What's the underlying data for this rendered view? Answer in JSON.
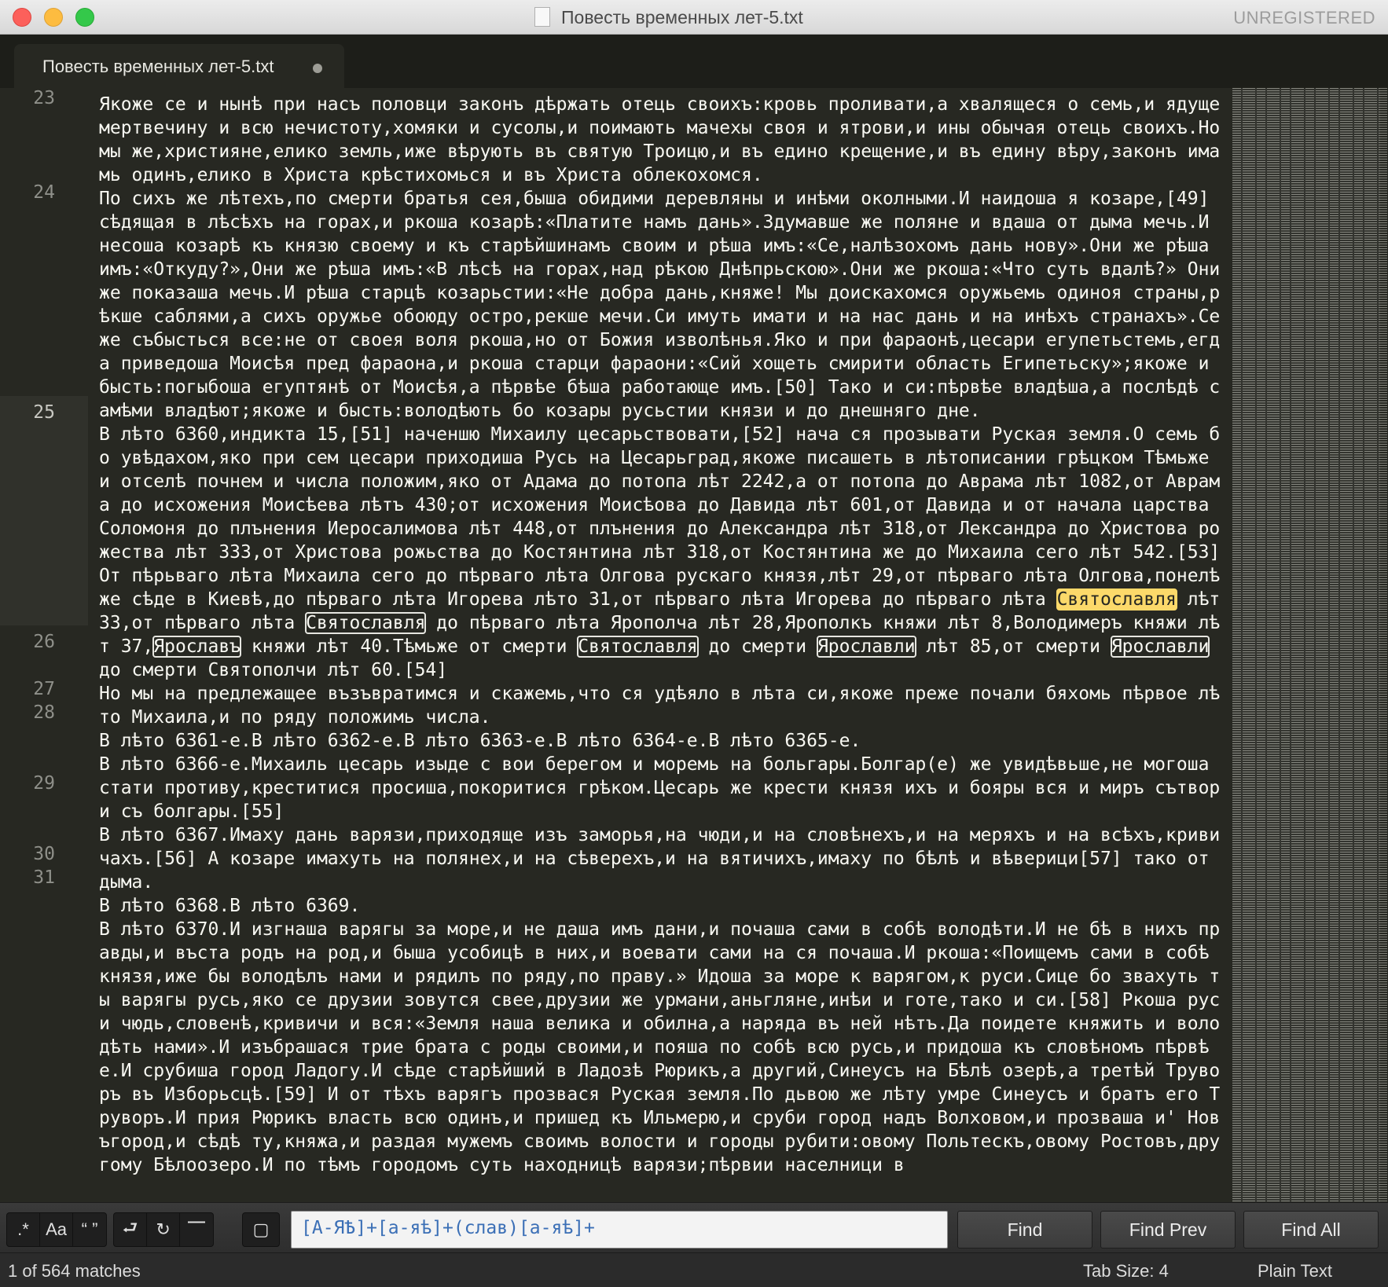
{
  "window": {
    "title": "Повесть временных лет-5.txt",
    "registration": "UNREGISTERED"
  },
  "tab": {
    "label": "Повесть временных лет-5.txt"
  },
  "editor": {
    "line_numbers": [
      "23",
      "24",
      "25",
      "26",
      "27",
      "28",
      "29",
      "30",
      "31"
    ],
    "active_line": "25",
    "paragraphs": [
      "Якоже се и нынѣ при насъ половци законъ дѣржать отець своихъ:кровь проливати,а хвалящеся о семь,и ядуще мертвечину и всю нечистоту,хомяки и сусолы,и поимають мачехы своя и ятрови,и ины обычая отець своихъ.Но мы же,християне,елико земль,иже вѣрують въ святую Троицю,и въ едино крещение,и въ едину вѣру,законъ имамь одинъ,елико в Христа крѣстихомься и въ Христа облекохомся.",
      "По сихъ же лѣтехъ,по смерти братья сея,быша обидими деревляны и инѣми околными.И наидоша я козаре,[49] сѣдящая в лѣсѣхъ на горах,и ркоша козарѣ:«Платите намъ дань».Здумавше же поляне и вдаша от дыма мечь.И несоша козарѣ къ князю своему и къ старѣйшинамъ своим и рѣша имъ:«Се,налѣзохомъ дань нову».Они же рѣша имъ:«Откуду?»,Они же рѣша имъ:«В лѣсѣ на горах,над рѣкою Днѣпрьскою».Они же ркоша:«Что суть вдалѣ?» Они же показаша мечь.И рѣша старцѣ козарьстии:«Не добра дань,княже! Мы доискахомся оружьемь одиноя страны,рѣкше саблями,а сихъ оружье обоюду остро,рекше мечи.Си имуть имати и на нас дань и на инѣхъ странахъ».Се же събысться все:не от своея воля ркоша,но от Божия изволѣнья.Яко и при фараонѣ,цесари егупетьстемь,егда приведоша Моисѣя пред фараона,и ркоша старци фараони:«Сий хощеть смирити область Египетьску»;якоже и бысть:погыбоша егуптянѣ от Моисѣя,а пѣрвѣе бѣша работающе имъ.[50] Тако и си:пѣрвѣе владѣша,а послѣдѣ самѣми владѣют;якоже и бысть:володѣють бо козары русьстии князи и до днешняго дне.",
      "В лѣто 6360,индикта 15,[51] наченшю Михаилу цесарьствовати,[52] нача ся прозывати Руская земля.О семь бо увѣдахом,яко при сем цесари приходиша Русь на Цесарьград,якоже писашеть в лѣтописании грѣцком Тѣмьже и отселѣ почнем и числа положим,яко от Адама до потопа лѣт 2242,а от потопа до Аврама лѣт 1082,от Аврама до исхожения Моисѣева лѣтъ 430;от исхожения Моисѣова до Давида лѣт 601,от Давида и от начала царства Соломоня до плънения Иеросалимова лѣт 448,от плънения до Александра лѣт 318,от Лександра до Христова рожества лѣт 333,от Христова рожьства до Костянтина лѣт 318,от Костянтина же до Михаила сего лѣт 542.[53] От пѣрьваго лѣта Михаила сего до пѣрваго лѣта Олгова рускаго князя,лѣт 29,от пѣрваго лѣта Олгова,понелѣже сѣде в Киевѣ,до пѣрваго лѣта Игорева лѣто 31,от пѣрваго лѣта Игорева до пѣрваго лѣта Святославля лѣт 33,от пѣрваго лѣта Святославля до пѣрваго лѣта Ярополча лѣт 28,Ярополкъ княжи лѣт 8,Володимеръ княжи лѣт 37,Ярославъ княжи лѣт 40.Тѣмьже от смерти Святославля до смерти Ярославли лѣт 85,от смерти Ярославли до смерти Святополчи лѣт 60.[54]",
      "Но мы на предлежащее възъвратимся и скажемь,что ся удѣяло в лѣта си,якоже преже почали бяхомь пѣрвое лѣто Михаила,и по ряду положимь числа.",
      "В лѣто 6361-е.В лѣто 6362-е.В лѣто 6363-е.В лѣто 6364-е.В лѣто 6365-е.",
      "В лѣто 6366-е.Михаиль цесарь изыде с вои берегом и моремь на больгары.Болгар(е) же увидѣвьше,не могоша стати противу,креститися просиша,покоритися грѣком.Цесарь же крести князя ихъ и бояры вся и миръ сътвори съ болгары.[55]",
      "В лѣто 6367.Имаху дань варязи,приходяще изъ заморья,на чюди,и на словѣнехъ,и на меряхъ и на всѣхъ,кривичахъ.[56] А козаре имахуть на полянех,и на сѣверехъ,и на вятичихъ,имаху по бѣлѣ и вѣверици[57] тако от дыма.",
      "В лѣто 6368.В лѣто 6369.",
      "В лѣто 6370.И изгнаша варягы за море,и не даша имъ дани,и почаша сами в собѣ володѣти.И не бѣ в нихъ правды,и въста родъ на род,и быша усобицѣ в них,и воевати сами на ся почаша.И ркоша:«Поищемъ сами в собѣ князя,иже бы володѣлъ нами и рядилъ по ряду,по праву.» Идоша за море к варягом,к руси.Сице бо звахуть ты варягы русь,яко се друзии зовутся свее,друзии же урмани,аньгляне,инѣи и готе,тако и си.[58] Ркоша руси чюдь,словенѣ,кривичи и вся:«Земля наша велика и обилна,а наряда въ ней нѣтъ.Да поидете княжить и володѣть нами».И изъбрашася трие брата с роды своими,и пояша по собѣ всю русь,и придоша къ словѣномъ пѣрвѣе.И срубиша город Ладогу.И сѣде старѣйший в Ладозѣ Рюрикъ,а другий,Синеусъ на Бѣлѣ озерѣ,а третѣй Труворъ въ Изборьсцѣ.[59] И от тѣхъ варягъ прозвася Руская земля.По дьвою же лѣту умре Синеусъ и братъ его Труворъ.И прия Рюрикъ власть всю одинъ,и пришед къ Ильмерю,и сруби город надъ Волховом,и прозваша и' Новъгород,и сѣдѣ ту,княжа,и раздая мужемъ своимъ волости и городы рубити:овому Польтескъ,овому Ростовъ,другому Бѣлоозеро.И по тѣмъ городомъ суть находницѣ варязи;пѣрвии населници в"
    ]
  },
  "find_bar": {
    "options": [
      {
        "name": "regex",
        "glyph": ".*"
      },
      {
        "name": "case-sensitive",
        "glyph": "Aa"
      },
      {
        "name": "whole-word",
        "glyph": "“ ”"
      },
      {
        "name": "wrap",
        "glyph": "⮐"
      },
      {
        "name": "in-selection",
        "glyph": "↻"
      },
      {
        "name": "highlight",
        "glyph": "⎺"
      },
      {
        "name": "context",
        "glyph": "▢"
      }
    ],
    "query": "[А-ЯѢ]+[а-яѣ]+(слав)[а-яѣ]+",
    "find_label": "Find",
    "find_prev_label": "Find Prev",
    "find_all_label": "Find All"
  },
  "status_bar": {
    "matches": "1 of 564 matches",
    "tab_size": "Tab Size: 4",
    "syntax": "Plain Text"
  },
  "colors": {
    "background": "#272822",
    "text": "#f8f8f2",
    "current_match": "#fcd96a",
    "line_number": "#8f908a"
  }
}
